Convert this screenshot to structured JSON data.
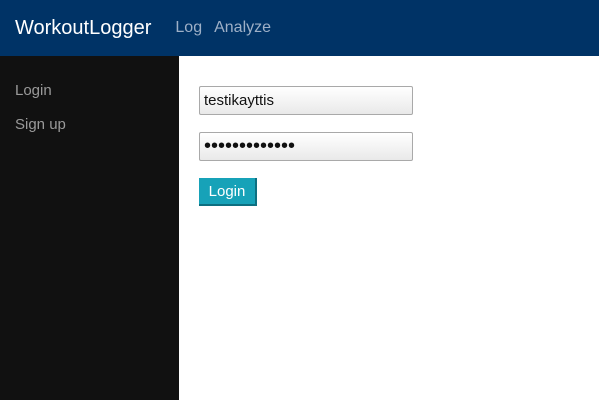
{
  "navbar": {
    "brand": "WorkoutLogger",
    "links": [
      {
        "label": "Log"
      },
      {
        "label": "Analyze"
      }
    ]
  },
  "sidebar": {
    "items": [
      {
        "label": "Login"
      },
      {
        "label": "Sign up"
      }
    ]
  },
  "form": {
    "username_value": "testikayttis",
    "password_value": "testisalasana",
    "submit_label": "Login"
  },
  "colors": {
    "navbar_bg": "#003366",
    "sidebar_bg": "#111111",
    "button_bg": "#17a2b8"
  }
}
